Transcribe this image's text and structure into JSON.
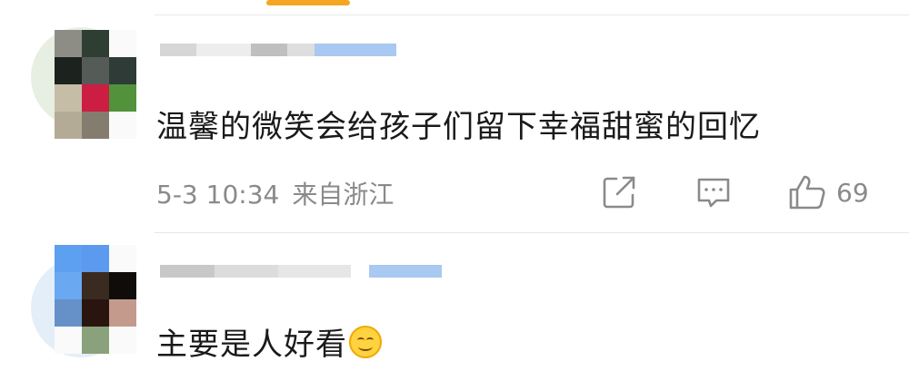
{
  "header": {
    "active_tab_indicator": "active-tab-underline"
  },
  "comments": [
    {
      "author_name": "",
      "text": "温馨的微笑会给孩子们留下幸福甜蜜的回忆",
      "time": "5-3 10:34",
      "location": "来自浙江",
      "like_count": "69",
      "icons": [
        "share-icon",
        "comment-icon",
        "like-icon"
      ]
    },
    {
      "author_name": "",
      "text": "主要是人好看",
      "emoji": "smile-emoji"
    }
  ],
  "colors": {
    "accent": "#f5a623",
    "meta_text": "#8a8a8a",
    "body_text": "#1a1a1a"
  }
}
